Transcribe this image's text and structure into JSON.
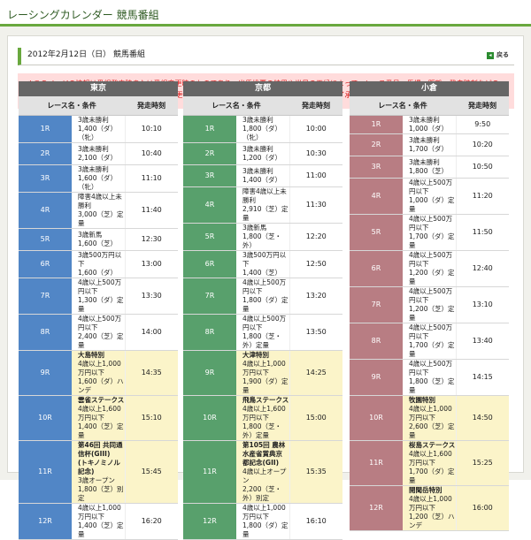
{
  "header": {
    "title": "レーシングカレンダー 競馬番組"
  },
  "subtitle": "2012年2月12日（日） 競馬番組",
  "back_label": "戻る",
  "back_icon": "arrow-left-icon",
  "notice": "※このページの情報は番組発表時または番組変更時のものであり、出馬投票の結果や当日の天候によって、レース番号、馬場、距離、発走時刻などの変更や、レースの中止・延期といった追加・変更情報が発生する場合がございます。あらかじめご了承ください。",
  "columns_header": {
    "race": "レース名・条件",
    "time": "発走時刻"
  },
  "venues": [
    {
      "name": "東京",
      "races": [
        {
          "no": "1R",
          "lines": [
            "3歳未勝利",
            "1,400（ダ）（牝）"
          ],
          "time": "10:10"
        },
        {
          "no": "2R",
          "lines": [
            "3歳未勝利",
            "2,100（ダ）"
          ],
          "time": "10:40"
        },
        {
          "no": "3R",
          "lines": [
            "3歳未勝利",
            "1,600（ダ）（牝）"
          ],
          "time": "11:10"
        },
        {
          "no": "4R",
          "lines": [
            "障害4歳以上未勝利",
            "3,000（芝）定量"
          ],
          "time": "11:40"
        },
        {
          "no": "5R",
          "lines": [
            "3歳新馬",
            "1,600（芝）"
          ],
          "time": "12:30"
        },
        {
          "no": "6R",
          "lines": [
            "3歳500万円以下",
            "1,600（ダ）"
          ],
          "time": "13:00"
        },
        {
          "no": "7R",
          "lines": [
            "4歳以上500万円以下",
            "1,300（ダ）定量"
          ],
          "time": "13:30"
        },
        {
          "no": "8R",
          "lines": [
            "4歳以上500万円以下",
            "2,400（芝）定量"
          ],
          "time": "14:00"
        },
        {
          "no": "9R",
          "name": "大島特別",
          "lines": [
            "4歳以上1,000万円以下",
            "1,600（ダ）ハンデ"
          ],
          "time": "14:35"
        },
        {
          "no": "10R",
          "name": "雲雀ステークス",
          "lines": [
            "4歳以上1,600万円以下",
            "1,400（芝）定量"
          ],
          "time": "15:10"
        },
        {
          "no": "11R",
          "name": "第46回 共同通信杯(GIII)",
          "name2": "(トキノミノル記念)",
          "lines": [
            "3歳オープン",
            "1,800（芝）別定"
          ],
          "time": "15:45"
        },
        {
          "no": "12R",
          "lines": [
            "4歳以上1,000万円以下",
            "1,400（芝）定量"
          ],
          "time": "16:20"
        }
      ]
    },
    {
      "name": "京都",
      "races": [
        {
          "no": "1R",
          "lines": [
            "3歳未勝利",
            "1,800（ダ）（牝）"
          ],
          "time": "10:00"
        },
        {
          "no": "2R",
          "lines": [
            "3歳未勝利",
            "1,200（ダ）"
          ],
          "time": "10:30"
        },
        {
          "no": "3R",
          "lines": [
            "3歳未勝利",
            "1,400（ダ）"
          ],
          "time": "11:00"
        },
        {
          "no": "4R",
          "lines": [
            "障害4歳以上未勝利",
            "2,910（芝）定量"
          ],
          "time": "11:30"
        },
        {
          "no": "5R",
          "lines": [
            "3歳新馬",
            "1,800（芝・外）"
          ],
          "time": "12:20"
        },
        {
          "no": "6R",
          "lines": [
            "3歳500万円以下",
            "1,400（芝）"
          ],
          "time": "12:50"
        },
        {
          "no": "7R",
          "lines": [
            "4歳以上500万円以下",
            "1,800（ダ）定量"
          ],
          "time": "13:20"
        },
        {
          "no": "8R",
          "lines": [
            "4歳以上500万円以下",
            "1,800（芝・外）定量"
          ],
          "time": "13:50"
        },
        {
          "no": "9R",
          "name": "大津特別",
          "lines": [
            "4歳以上1,000万円以下",
            "1,900（ダ）定量"
          ],
          "time": "14:25"
        },
        {
          "no": "10R",
          "name": "飛鳥ステークス",
          "lines": [
            "4歳以上1,600万円以下",
            "1,800（芝・外）定量"
          ],
          "time": "15:00"
        },
        {
          "no": "11R",
          "name": "第105回 農林水産省賞典京",
          "name2": "都記念(GII)",
          "lines": [
            "4歳以上オープン",
            "2,200（芝・外）別定"
          ],
          "time": "15:35"
        },
        {
          "no": "12R",
          "lines": [
            "4歳以上1,000万円以下",
            "1,800（ダ）定量"
          ],
          "time": "16:10"
        }
      ]
    },
    {
      "name": "小倉",
      "races": [
        {
          "no": "1R",
          "lines": [
            "3歳未勝利",
            "1,000（ダ）"
          ],
          "time": "9:50"
        },
        {
          "no": "2R",
          "lines": [
            "3歳未勝利",
            "1,700（ダ）"
          ],
          "time": "10:20"
        },
        {
          "no": "3R",
          "lines": [
            "3歳未勝利",
            "1,800（芝）"
          ],
          "time": "10:50"
        },
        {
          "no": "4R",
          "lines": [
            "4歳以上500万円以下",
            "1,000（ダ）定量"
          ],
          "time": "11:20"
        },
        {
          "no": "5R",
          "lines": [
            "4歳以上500万円以下",
            "1,700（ダ）定量"
          ],
          "time": "11:50"
        },
        {
          "no": "6R",
          "lines": [
            "4歳以上500万円以下",
            "1,200（ダ）定量"
          ],
          "time": "12:40"
        },
        {
          "no": "7R",
          "lines": [
            "4歳以上500万円以下",
            "1,200（芝）定量"
          ],
          "time": "13:10"
        },
        {
          "no": "8R",
          "lines": [
            "4歳以上500万円以下",
            "1,700（ダ）定量"
          ],
          "time": "13:40"
        },
        {
          "no": "9R",
          "lines": [
            "4歳以上500万円以下",
            "1,800（芝）定量"
          ],
          "time": "14:15"
        },
        {
          "no": "10R",
          "name": "牧園特別",
          "lines": [
            "4歳以上1,000万円以下",
            "2,600（芝）定量"
          ],
          "time": "14:50"
        },
        {
          "no": "11R",
          "name": "桜島ステークス",
          "lines": [
            "4歳以上1,600万円以下",
            "1,700（ダ）定量"
          ],
          "time": "15:25"
        },
        {
          "no": "12R",
          "name": "開聞岳特別",
          "lines": [
            "4歳以上1,000万円以下",
            "1,200（芝）ハンデ"
          ],
          "time": "16:00"
        }
      ]
    }
  ]
}
